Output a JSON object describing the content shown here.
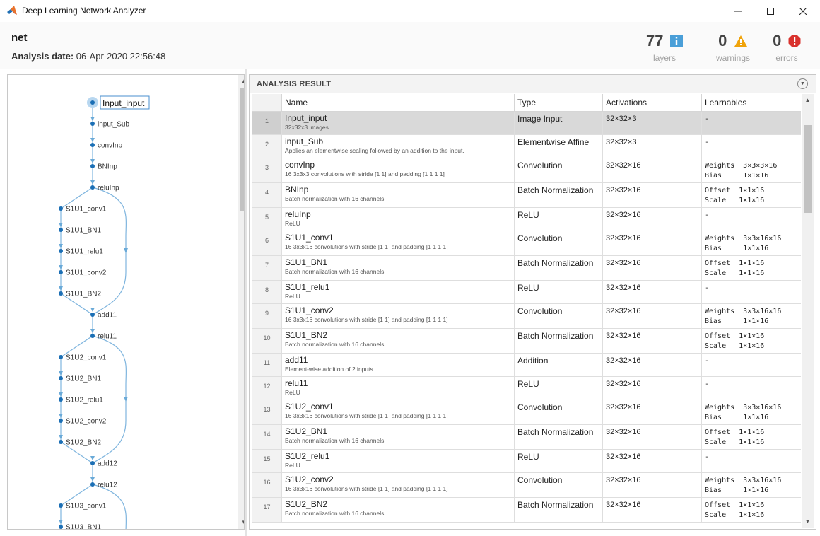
{
  "window": {
    "title": "Deep Learning Network Analyzer"
  },
  "summary": {
    "network_name": "net",
    "date_label": "Analysis date:",
    "date_value": "06-Apr-2020 22:56:48",
    "layers": {
      "count": "77",
      "label": "layers",
      "icon": "info-icon",
      "color": "#4a9fd8"
    },
    "warnings": {
      "count": "0",
      "label": "warnings",
      "icon": "warning-icon",
      "color": "#f0a30a"
    },
    "errors": {
      "count": "0",
      "label": "errors",
      "icon": "error-icon",
      "color": "#d9322d"
    }
  },
  "graph": {
    "nodes": [
      "Input_input",
      "input_Sub",
      "convInp",
      "BNInp",
      "reluInp",
      "S1U1_conv1",
      "S1U1_BN1",
      "S1U1_relu1",
      "S1U1_conv2",
      "S1U1_BN2",
      "add11",
      "relu11",
      "S1U2_conv1",
      "S1U2_BN1",
      "S1U2_relu1",
      "S1U2_conv2",
      "S1U2_BN2",
      "add12",
      "relu12",
      "S1U3_conv1",
      "S1U3_BN1"
    ]
  },
  "results": {
    "header": "ANALYSIS RESULT",
    "columns": [
      "Name",
      "Type",
      "Activations",
      "Learnables"
    ],
    "rows": [
      {
        "idx": "1",
        "name": "Input_input",
        "desc": "32x32x3 images",
        "type": "Image Input",
        "act": "32×32×3",
        "learn": "-"
      },
      {
        "idx": "2",
        "name": "input_Sub",
        "desc": "Applies an elementwise scaling followed by an addition to the input.",
        "type": "Elementwise Affine",
        "act": "32×32×3",
        "learn": "-"
      },
      {
        "idx": "3",
        "name": "convInp",
        "desc": "16 3x3x3 convolutions with stride [1 1] and padding [1 1 1 1]",
        "type": "Convolution",
        "act": "32×32×16",
        "learn": "Weights  3×3×3×16\nBias     1×1×16"
      },
      {
        "idx": "4",
        "name": "BNInp",
        "desc": "Batch normalization with 16 channels",
        "type": "Batch Normalization",
        "act": "32×32×16",
        "learn": "Offset  1×1×16\nScale   1×1×16"
      },
      {
        "idx": "5",
        "name": "reluInp",
        "desc": "ReLU",
        "type": "ReLU",
        "act": "32×32×16",
        "learn": "-"
      },
      {
        "idx": "6",
        "name": "S1U1_conv1",
        "desc": "16 3x3x16 convolutions with stride [1 1] and padding [1 1 1 1]",
        "type": "Convolution",
        "act": "32×32×16",
        "learn": "Weights  3×3×16×16\nBias     1×1×16"
      },
      {
        "idx": "7",
        "name": "S1U1_BN1",
        "desc": "Batch normalization with 16 channels",
        "type": "Batch Normalization",
        "act": "32×32×16",
        "learn": "Offset  1×1×16\nScale   1×1×16"
      },
      {
        "idx": "8",
        "name": "S1U1_relu1",
        "desc": "ReLU",
        "type": "ReLU",
        "act": "32×32×16",
        "learn": "-"
      },
      {
        "idx": "9",
        "name": "S1U1_conv2",
        "desc": "16 3x3x16 convolutions with stride [1 1] and padding [1 1 1 1]",
        "type": "Convolution",
        "act": "32×32×16",
        "learn": "Weights  3×3×16×16\nBias     1×1×16"
      },
      {
        "idx": "10",
        "name": "S1U1_BN2",
        "desc": "Batch normalization with 16 channels",
        "type": "Batch Normalization",
        "act": "32×32×16",
        "learn": "Offset  1×1×16\nScale   1×1×16"
      },
      {
        "idx": "11",
        "name": "add11",
        "desc": "Element-wise addition of 2 inputs",
        "type": "Addition",
        "act": "32×32×16",
        "learn": "-"
      },
      {
        "idx": "12",
        "name": "relu11",
        "desc": "ReLU",
        "type": "ReLU",
        "act": "32×32×16",
        "learn": "-"
      },
      {
        "idx": "13",
        "name": "S1U2_conv1",
        "desc": "16 3x3x16 convolutions with stride [1 1] and padding [1 1 1 1]",
        "type": "Convolution",
        "act": "32×32×16",
        "learn": "Weights  3×3×16×16\nBias     1×1×16"
      },
      {
        "idx": "14",
        "name": "S1U2_BN1",
        "desc": "Batch normalization with 16 channels",
        "type": "Batch Normalization",
        "act": "32×32×16",
        "learn": "Offset  1×1×16\nScale   1×1×16"
      },
      {
        "idx": "15",
        "name": "S1U2_relu1",
        "desc": "ReLU",
        "type": "ReLU",
        "act": "32×32×16",
        "learn": "-"
      },
      {
        "idx": "16",
        "name": "S1U2_conv2",
        "desc": "16 3x3x16 convolutions with stride [1 1] and padding [1 1 1 1]",
        "type": "Convolution",
        "act": "32×32×16",
        "learn": "Weights  3×3×16×16\nBias     1×1×16"
      },
      {
        "idx": "17",
        "name": "S1U2_BN2",
        "desc": "Batch normalization with 16 channels",
        "type": "Batch Normalization",
        "act": "32×32×16",
        "learn": "Offset  1×1×16\nScale   1×1×16"
      }
    ]
  }
}
